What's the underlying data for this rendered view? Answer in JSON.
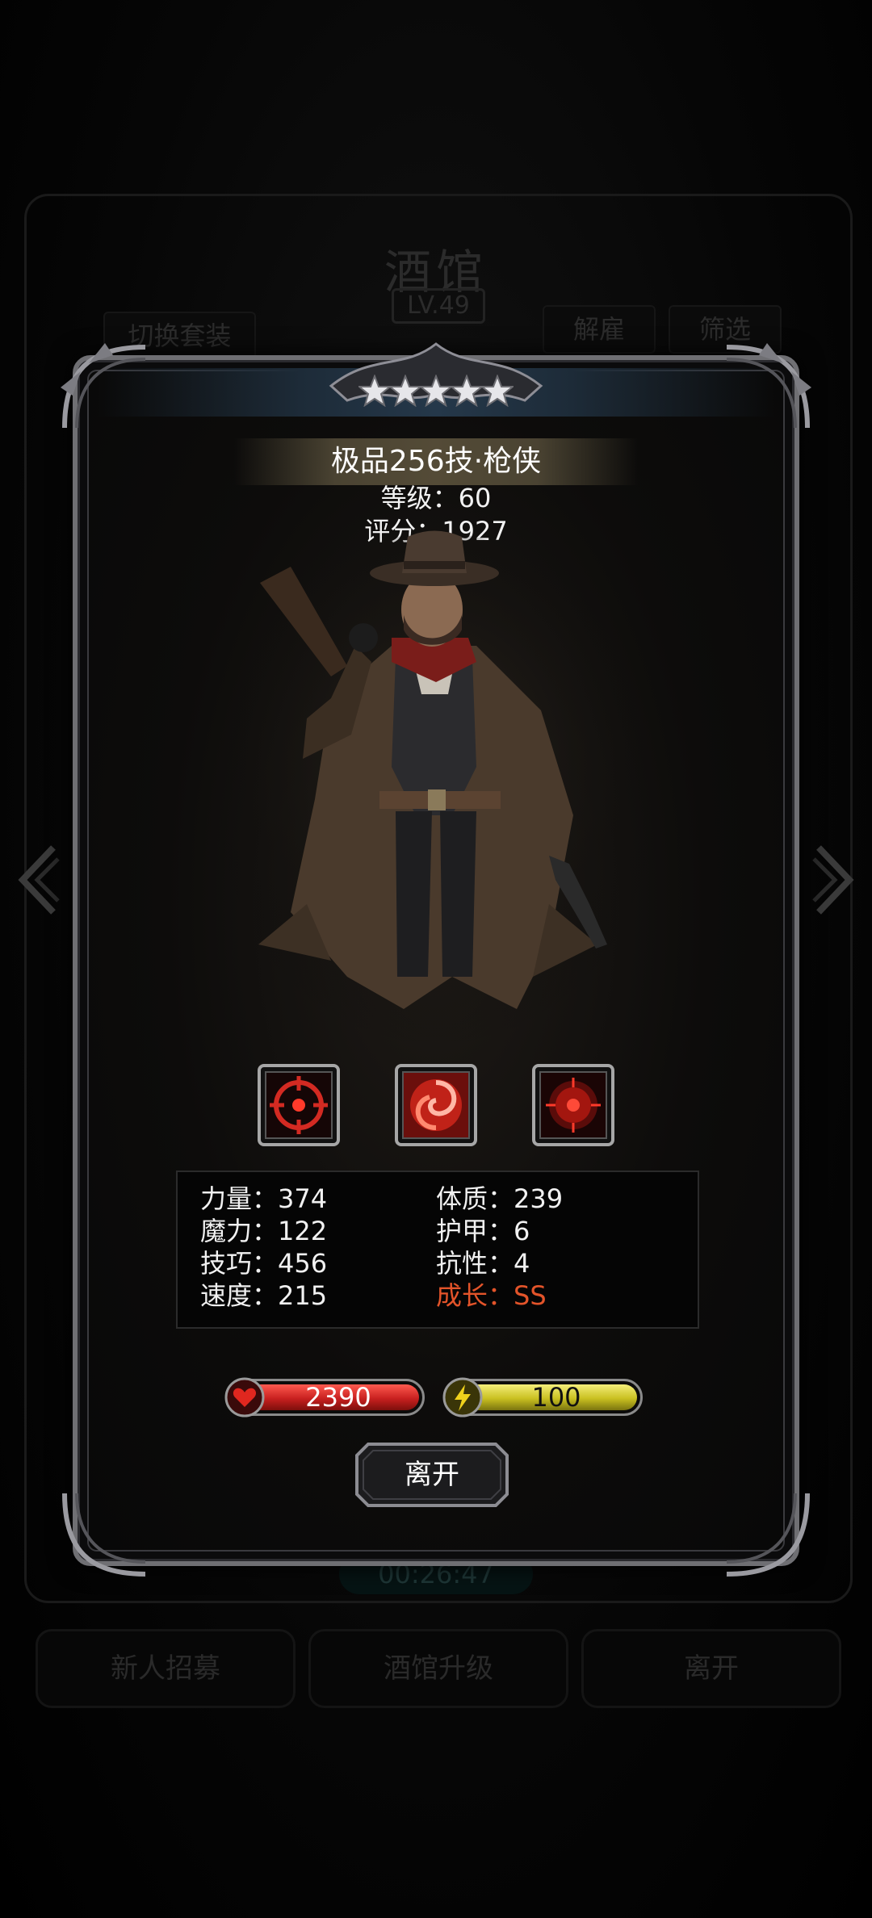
{
  "background": {
    "title": "酒馆",
    "level": "LV.49",
    "buttons": {
      "switch_set": "切换套装",
      "dismiss": "解雇",
      "filter": "筛选"
    },
    "timer": "00:26:47",
    "bottom_buttons": {
      "recruit": "新人招募",
      "upgrade": "酒馆升级",
      "leave": "离开"
    }
  },
  "hero": {
    "stars": 5,
    "name": "极品256技·枪侠",
    "level_text": "等级：60",
    "score_text": "评分：1927",
    "skills": [
      "crosshair-skill-icon",
      "vortex-skill-icon",
      "target-skill-icon"
    ],
    "attributes_left": [
      "力量：374",
      "魔力：122",
      "技巧：456",
      "速度：215"
    ],
    "attributes_right": [
      "体质：239",
      "护甲：6",
      "抗性：4"
    ],
    "growth": "成长：SS",
    "hp": "2390",
    "energy": "100",
    "leave_label": "离开"
  },
  "colors": {
    "growth": "#e3542a",
    "hp_bar": "#c8201f",
    "energy_bar": "#c9c020"
  }
}
